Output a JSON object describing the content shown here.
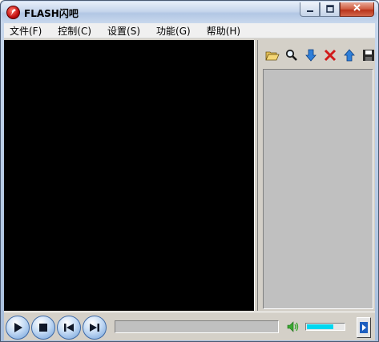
{
  "window": {
    "title": "FLASH闪吧",
    "icon": "flash-logo-icon",
    "buttons": {
      "minimize": "minimize-icon",
      "maximize": "maximize-icon",
      "close": "close-icon"
    }
  },
  "menu": {
    "items": [
      {
        "label": "文件(F)"
      },
      {
        "label": "控制(C)"
      },
      {
        "label": "设置(S)"
      },
      {
        "label": "功能(G)"
      },
      {
        "label": "帮助(H)"
      }
    ]
  },
  "playlist_toolbar": {
    "tools": [
      "open-folder-icon",
      "search-icon",
      "move-down-icon",
      "delete-icon",
      "move-up-icon",
      "save-icon"
    ]
  },
  "controls": {
    "buttons": [
      "play-icon",
      "stop-icon",
      "previous-icon",
      "next-icon"
    ],
    "progress": 0,
    "volume": 0.68
  },
  "colors": {
    "video_bg": "#000000",
    "panel_bg": "#d4d0c8",
    "volume_fill": "#00d8f0",
    "button_blue": "#6f9fd8"
  }
}
